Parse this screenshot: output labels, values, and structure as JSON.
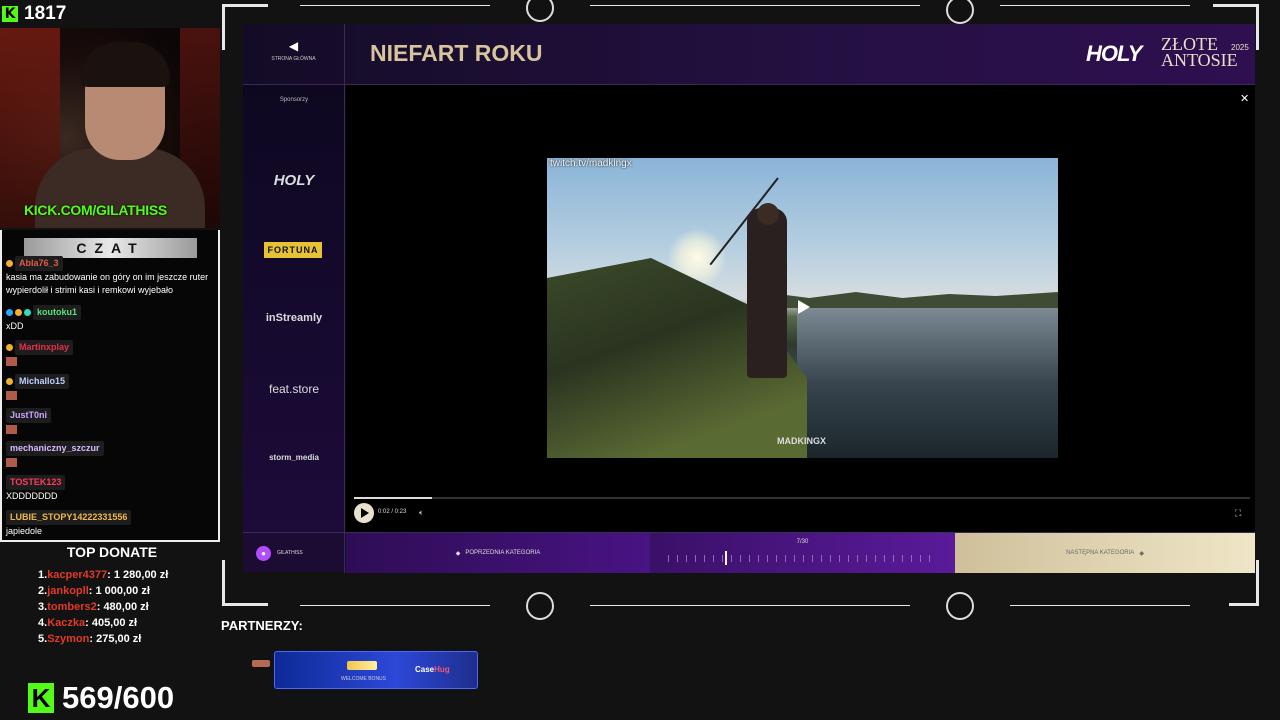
{
  "viewers": {
    "icon": "kick-logo-icon",
    "count": "1817"
  },
  "webcam": {
    "overlay_text": "KICK.COM/GILATHISS"
  },
  "chat": {
    "title": "CZAT",
    "messages": [
      {
        "user": "Abla76_3",
        "text": "kasia ma zabudowanie on góry on im jeszcze ruter wypierdolił i strimi kasi i remkowi wyjebało"
      },
      {
        "user": "koutoku1",
        "text": "xDD"
      },
      {
        "user": "Martinxplay",
        "text": ""
      },
      {
        "user": "Michallo15",
        "text": ""
      },
      {
        "user": "JustT0ni",
        "text": ""
      },
      {
        "user": "mechaniczny_szczur",
        "text": ""
      },
      {
        "user": "TOSTEK123",
        "text": "XDDDDDDD"
      },
      {
        "user": "LUBIE_STOPY14222331556",
        "text": "japiedole"
      }
    ]
  },
  "top_donate": {
    "title": "TOP DONATE",
    "entries": [
      {
        "rank": "1.",
        "name": "kacper4377",
        "amount": ": 1 280,00 zł"
      },
      {
        "rank": "2.",
        "name": "jankopll",
        "amount": ": 1 000,00 zł"
      },
      {
        "rank": "3.",
        "name": "tombers2",
        "amount": ": 480,00 zł"
      },
      {
        "rank": "4.",
        "name": "Kaczka",
        "amount": ": 405,00 zł"
      },
      {
        "rank": "5.",
        "name": "Szymon",
        "amount": ": 275,00 zł"
      }
    ]
  },
  "goal": {
    "icon": "kick-logo-icon",
    "value": "569/600"
  },
  "partners": {
    "label": "PARTNERZY:",
    "promo_small": "WELCOME BONUS",
    "promo_brand": "Case",
    "promo_brand_accent": "Hug"
  },
  "app": {
    "home_label": "STRONA GŁÓWNA",
    "category_title": "NIEFART ROKU",
    "logo_holy": "HOLY",
    "logo_zlote": "ZŁOTE",
    "logo_antosie": "ANTOSIE",
    "logo_year": "2025",
    "sponsors_label": "Sponsorzy",
    "sponsors": [
      "HOLY",
      "FORTUNA",
      "inStreamly",
      "feat.store",
      "storm_media"
    ],
    "video": {
      "source": "twitch.tv/madkingx",
      "watermark": "MADKINGX",
      "time": "0:02 / 0:23",
      "progress": 0.087
    },
    "bottom": {
      "user": "GILATHISS",
      "prev": "POPRZEDNIA KATEGORIA",
      "counter": "7/30",
      "next": "NASTĘPNA KATEGORIA"
    }
  }
}
